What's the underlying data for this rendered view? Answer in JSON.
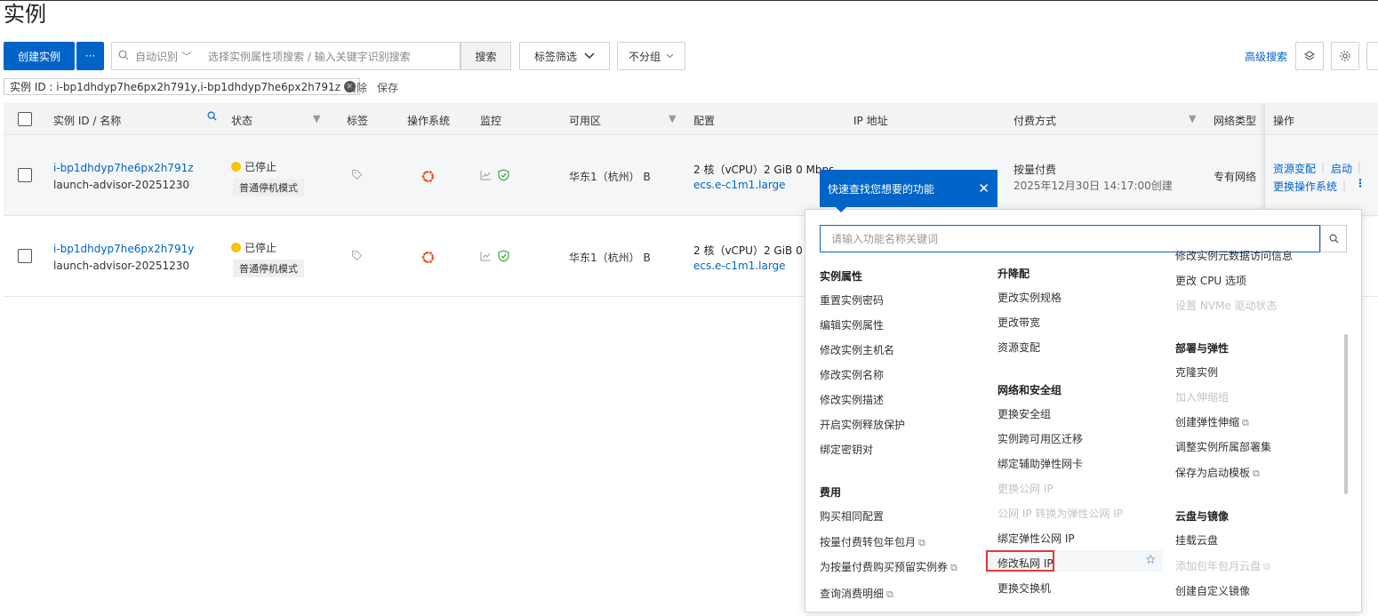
{
  "page": {
    "title": "实例"
  },
  "toolbar": {
    "create_label": "创建实例",
    "more_label": "···",
    "auto_detect": "自动识别 ﹀",
    "search_placeholder": "选择实例属性项搜索 / 输入关键字识别搜索",
    "search_label": "搜索",
    "tag_filter_label": "标签筛选",
    "no_group_label": "不分组",
    "advanced_search_label": "高级搜索"
  },
  "filter_chip": {
    "text": "实例 ID : i-bp1dhdyp7he6px2h791y,i-bp1dhdyp7he6px2h791z",
    "clear_label": "清除",
    "save_label": "保存"
  },
  "table": {
    "columns": [
      "实例 ID / 名称",
      "状态",
      "标签",
      "操作系统",
      "监控",
      "可用区",
      "配置",
      "IP 地址",
      "付费方式",
      "网络类型",
      "操作"
    ],
    "rows": [
      {
        "id": "i-bp1dhdyp7he6px2h791z",
        "name": "launch-advisor-20251230",
        "status": "已停止",
        "stop_mode": "普通停机模式",
        "zone": "华东1（杭州） B",
        "config": "2 核（vCPU）2 GiB 0 Mbps",
        "spec": "ecs.e-c1m1.large",
        "billing": "按量付费",
        "created": "2025年12月30日 14:17:00创建",
        "network": "专有网络",
        "op1": "资源变配",
        "op2": "启动",
        "op3": "更换操作系统"
      },
      {
        "id": "i-bp1dhdyp7he6px2h791y",
        "name": "launch-advisor-20251230",
        "status": "已停止",
        "stop_mode": "普通停机模式",
        "zone": "华东1（杭州） B",
        "config": "2 核（vCPU）2 GiB 0",
        "spec": "ecs.e-c1m1.large"
      }
    ]
  },
  "popup": {
    "tip_title": "快速查找您想要的功能",
    "search_placeholder": "请输入功能名称关键词",
    "col1": {
      "sec1": "实例属性",
      "items1": [
        "重置实例密码",
        "编辑实例属性",
        "修改实例主机名",
        "修改实例名称",
        "修改实例描述",
        "开启实例释放保护",
        "绑定密钥对"
      ],
      "sec2": "费用",
      "items2": [
        "购买相同配置",
        "按量付费转包年包月",
        "为按量付费购买预留实例券",
        "查询消费明细"
      ]
    },
    "col2": {
      "sec1": "升降配",
      "items1": [
        "更改实例规格",
        "更改带宽",
        "资源变配"
      ],
      "sec2": "网络和安全组",
      "items2": [
        "更换安全组",
        "实例跨可用区迁移",
        "绑定辅助弹性网卡",
        "更换公网 IP",
        "公网 IP 转换为弹性公网 IP",
        "绑定弹性公网 IP",
        "修改私网 IP",
        "更换交换机"
      ]
    },
    "col3": {
      "top_items": [
        "修改实例元数据访问信息",
        "更改 CPU 选项",
        "设置 NVMe 驱动状态"
      ],
      "sec1": "部署与弹性",
      "items1": [
        "克隆实例",
        "加入伸缩组",
        "创建弹性伸缩",
        "调整实例所属部署集",
        "保存为启动模板"
      ],
      "sec2": "云盘与镜像",
      "items2": [
        "挂载云盘",
        "添加包年包月云盘",
        "创建自定义镜像"
      ]
    }
  }
}
